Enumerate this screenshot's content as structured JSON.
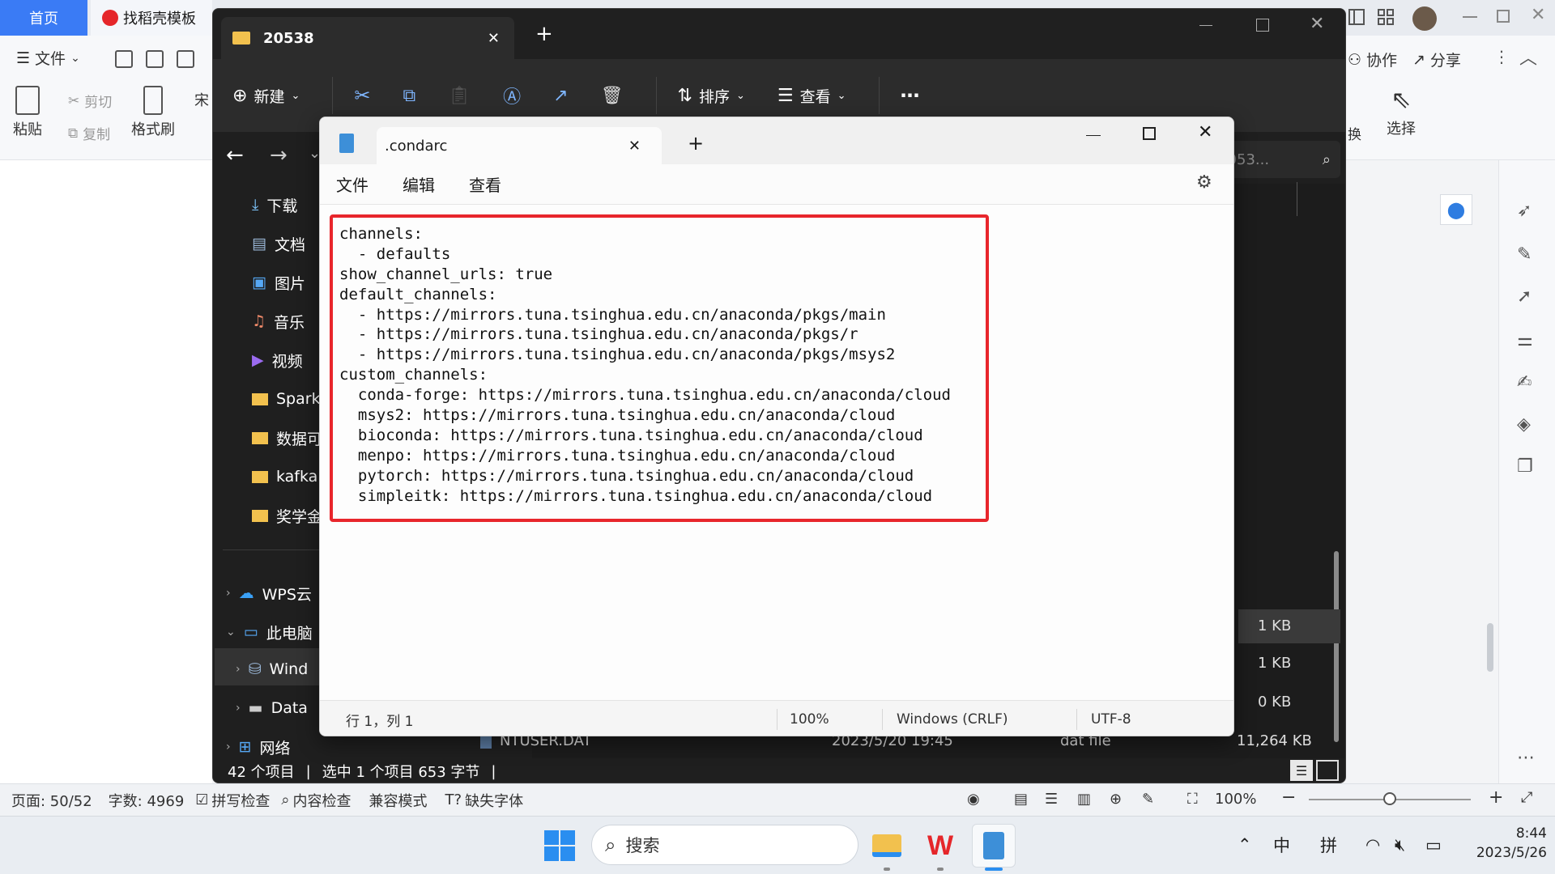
{
  "wps": {
    "tabs": {
      "home": "首页",
      "template": "找稻壳模板"
    },
    "menu": {
      "file": "文件",
      "collab": "协作",
      "share": "分享"
    },
    "ribbon": {
      "paste": "粘贴",
      "cut": "剪切",
      "copy": "复制",
      "format_painter": "格式刷",
      "replace": "换",
      "select": "选择",
      "font_prefix": "宋"
    },
    "status": {
      "page": "页面: 50/52",
      "words": "字数: 4969",
      "spellcheck": "拼写检查",
      "content_check": "内容检查",
      "compat_mode": "兼容模式",
      "missing_fonts": "缺失字体",
      "zoom": "100%"
    }
  },
  "explorer": {
    "tab_title": "20538",
    "toolbar": {
      "new": "新建",
      "sort": "排序",
      "view": "查看"
    },
    "search_placeholder": "E 2053...",
    "nav": {
      "downloads": "下载",
      "documents": "文档",
      "pictures": "图片",
      "music": "音乐",
      "videos": "视频",
      "spark": "Spark",
      "datavis": "数据可",
      "kafka": "kafka",
      "scholarship": "奖学金",
      "wps_cloud": "WPS云",
      "this_pc": "此电脑",
      "windows": "Wind",
      "data": "Data",
      "network": "网络"
    },
    "files": {
      "sizes": [
        "1 KB",
        "1 KB",
        "0 KB"
      ],
      "last_row": {
        "name": "NTUSER.DAT",
        "date": "2023/5/20 19:45",
        "type": "dat file",
        "size": "11,264 KB"
      }
    },
    "status": {
      "count": "42 个项目",
      "selected": "选中 1 个项目  653 字节"
    }
  },
  "notepad": {
    "tab_title": ".condarc",
    "menu": {
      "file": "文件",
      "edit": "编辑",
      "view": "查看"
    },
    "content_lines": [
      "channels:",
      "  - defaults",
      "show_channel_urls: true",
      "default_channels:",
      "  - https://mirrors.tuna.tsinghua.edu.cn/anaconda/pkgs/main",
      "  - https://mirrors.tuna.tsinghua.edu.cn/anaconda/pkgs/r",
      "  - https://mirrors.tuna.tsinghua.edu.cn/anaconda/pkgs/msys2",
      "custom_channels:",
      "  conda-forge: https://mirrors.tuna.tsinghua.edu.cn/anaconda/cloud",
      "  msys2: https://mirrors.tuna.tsinghua.edu.cn/anaconda/cloud",
      "  bioconda: https://mirrors.tuna.tsinghua.edu.cn/anaconda/cloud",
      "  menpo: https://mirrors.tuna.tsinghua.edu.cn/anaconda/cloud",
      "  pytorch: https://mirrors.tuna.tsinghua.edu.cn/anaconda/cloud",
      "  simpleitk: https://mirrors.tuna.tsinghua.edu.cn/anaconda/cloud"
    ],
    "status": {
      "position": "行 1，列 1",
      "zoom": "100%",
      "line_ending": "Windows (CRLF)",
      "encoding": "UTF-8"
    },
    "highlight_color": "#e8262c"
  },
  "taskbar": {
    "search": "搜索",
    "ime_lang": "中",
    "ime_mode": "拼",
    "time": "8:44",
    "date": "2023/5/26"
  },
  "colors": {
    "explorer_bg": "#1f1f1f",
    "wps_accent": "#3a7bf5",
    "notepad_bg": "#fdfdfd"
  }
}
